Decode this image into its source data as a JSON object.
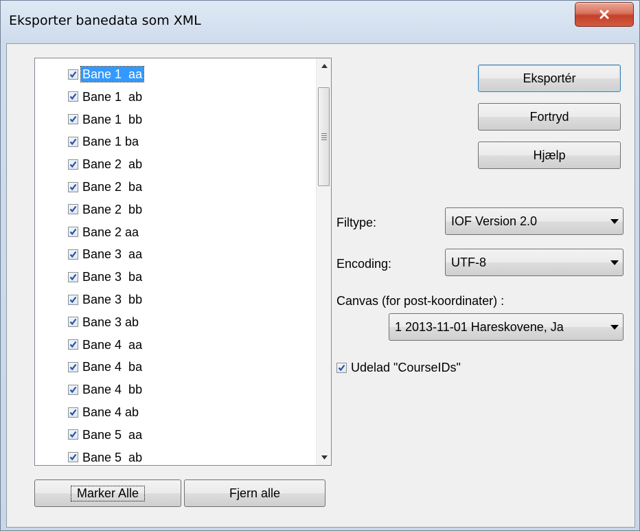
{
  "window": {
    "title": "Eksporter banedata som XML"
  },
  "courses": [
    "Bane 1  aa",
    "Bane 1  ab",
    "Bane 1  bb",
    "Bane 1 ba",
    "Bane 2  ab",
    "Bane 2  ba",
    "Bane 2  bb",
    "Bane 2 aa",
    "Bane 3  aa",
    "Bane 3  ba",
    "Bane 3  bb",
    "Bane 3 ab",
    "Bane 4  aa",
    "Bane 4  ba",
    "Bane 4  bb",
    "Bane 4 ab",
    "Bane 5  aa",
    "Bane 5  ab"
  ],
  "selected_index": 0,
  "buttons": {
    "export": "Eksportér",
    "cancel": "Fortryd",
    "help": "Hjælp",
    "select_all": "Marker Alle",
    "remove_all": "Fjern alle"
  },
  "filetype": {
    "label": "Filtype:",
    "value": "IOF Version 2.0"
  },
  "encoding": {
    "label": "Encoding:",
    "value": "UTF-8"
  },
  "canvas": {
    "label": "Canvas (for post-koordinater) :",
    "value": "1 2013-11-01 Hareskovene, Ja"
  },
  "omit_course_ids": {
    "label": "Udelad \"CourseIDs\"",
    "checked": true
  }
}
